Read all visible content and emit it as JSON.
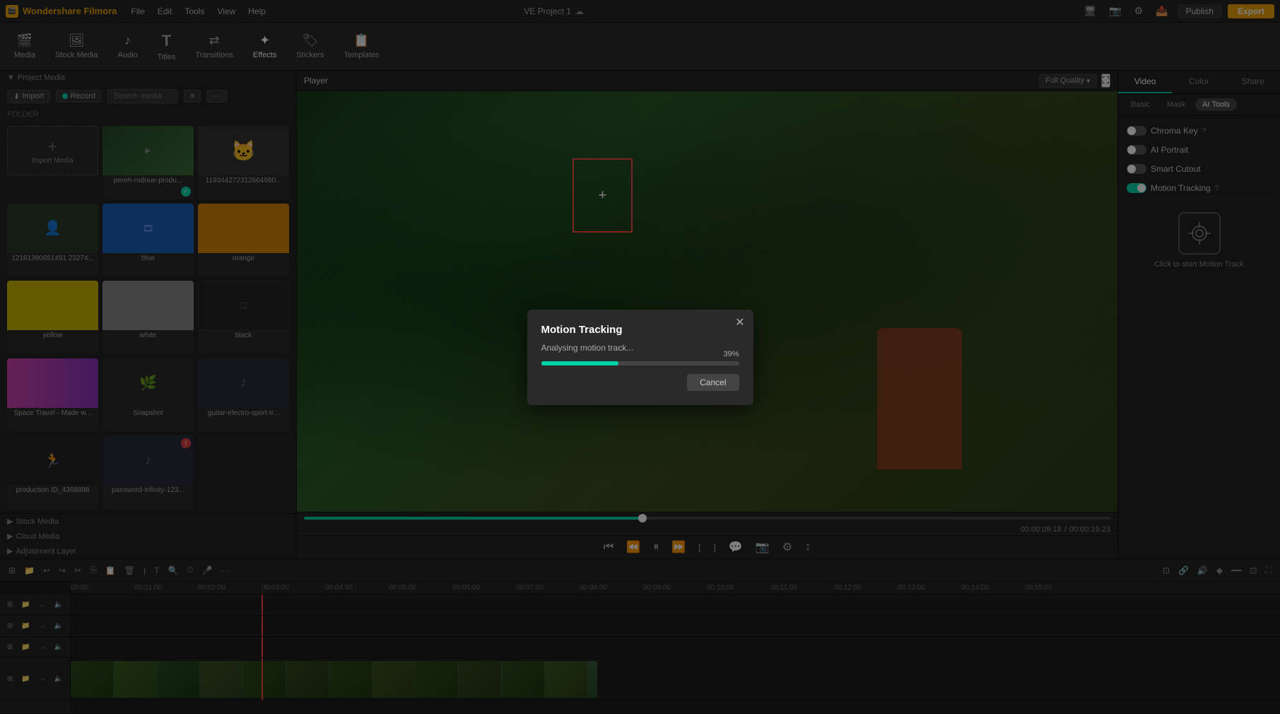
{
  "app": {
    "name": "Wondershare Filmora",
    "logo_char": "F",
    "project_name": "VE Project 1"
  },
  "topbar": {
    "menu": [
      "File",
      "Edit",
      "Tools",
      "View",
      "Help"
    ],
    "publish_label": "Publish",
    "export_label": "Export"
  },
  "toolbar": {
    "items": [
      {
        "id": "media",
        "label": "Media",
        "icon": "🎬"
      },
      {
        "id": "stock-media",
        "label": "Stock Media",
        "icon": "🖼️"
      },
      {
        "id": "audio",
        "label": "Audio",
        "icon": "🎵"
      },
      {
        "id": "titles",
        "label": "Titles",
        "icon": "T"
      },
      {
        "id": "transitions",
        "label": "Transitions",
        "icon": "↔"
      },
      {
        "id": "effects",
        "label": "Effects",
        "icon": "✨"
      },
      {
        "id": "stickers",
        "label": "Stickers",
        "icon": "🏷"
      },
      {
        "id": "templates",
        "label": "Templates",
        "icon": "📋"
      }
    ]
  },
  "left_panel": {
    "sections": [
      "Project Media",
      "Stock Media",
      "Cloud Media",
      "Adjustment Layer"
    ],
    "import_label": "Import",
    "record_label": "Record",
    "search_placeholder": "Search media",
    "folder_label": "FOLDER",
    "import_media_label": "Import Media",
    "media_items": [
      {
        "id": 1,
        "type": "video",
        "label": "pereh-rodnue-produ...",
        "has_check": true
      },
      {
        "id": 2,
        "type": "cat",
        "label": "119344272312664980..."
      },
      {
        "id": 3,
        "type": "face_video",
        "label": "12161390651491 23274...",
        "has_badge": false
      },
      {
        "id": 4,
        "type": "blue",
        "label": "blue"
      },
      {
        "id": 5,
        "type": "orange",
        "label": "orange"
      },
      {
        "id": 6,
        "type": "yellow",
        "label": "yellow"
      },
      {
        "id": 7,
        "type": "gray",
        "label": "white"
      },
      {
        "id": 8,
        "type": "black",
        "label": "black"
      },
      {
        "id": 9,
        "type": "pink",
        "label": "Space Travel - Made w..."
      },
      {
        "id": 10,
        "type": "video_gray",
        "label": "Snapshot"
      },
      {
        "id": 11,
        "type": "audio",
        "label": "guitar-electro-sport-tr..."
      },
      {
        "id": 12,
        "type": "video2",
        "label": "production ID_4368888"
      },
      {
        "id": 13,
        "type": "audio2",
        "label": "password-infinity-123...",
        "has_red_badge": true
      }
    ]
  },
  "preview": {
    "player_label": "Player",
    "quality_label": "Full Quality",
    "current_time": "00:00:09.18",
    "total_time": "00:00:19.23",
    "progress_pct": 42
  },
  "right_panel": {
    "tabs": [
      "Video",
      "Color",
      "Share"
    ],
    "sub_tabs": [
      "Basic",
      "Mask",
      "AI Tools"
    ],
    "active_tab": "Video",
    "active_sub_tab": "AI Tools",
    "ai_tools": [
      {
        "id": "chroma-key",
        "label": "Chroma Key",
        "enabled": false,
        "has_help": true
      },
      {
        "id": "ai-portrait",
        "label": "AI Portrait",
        "enabled": false
      },
      {
        "id": "smart-cutout",
        "label": "Smart Cutout",
        "enabled": false
      },
      {
        "id": "motion-tracking",
        "label": "Motion Tracking",
        "enabled": false,
        "has_help": true
      }
    ],
    "motion_tracking_text": "Click to start Motion Track"
  },
  "modal": {
    "title": "Motion Tracking",
    "subtitle": "Analysing motion track...",
    "progress_pct": 39,
    "progress_text": "39%",
    "cancel_label": "Cancel"
  },
  "timeline": {
    "tracks": [
      {
        "id": 1,
        "type": "empty",
        "icons": [
          "grid",
          "folder",
          "arrow",
          "mute"
        ]
      },
      {
        "id": 2,
        "type": "empty",
        "icons": [
          "grid",
          "folder",
          "arrow",
          "mute"
        ]
      },
      {
        "id": 3,
        "type": "empty",
        "icons": [
          "grid",
          "folder",
          "arrow",
          "mute"
        ]
      },
      {
        "id": 4,
        "type": "video",
        "icons": [
          "grid",
          "folder",
          "arrow",
          "mute"
        ]
      }
    ],
    "playhead_position_pct": 29
  }
}
